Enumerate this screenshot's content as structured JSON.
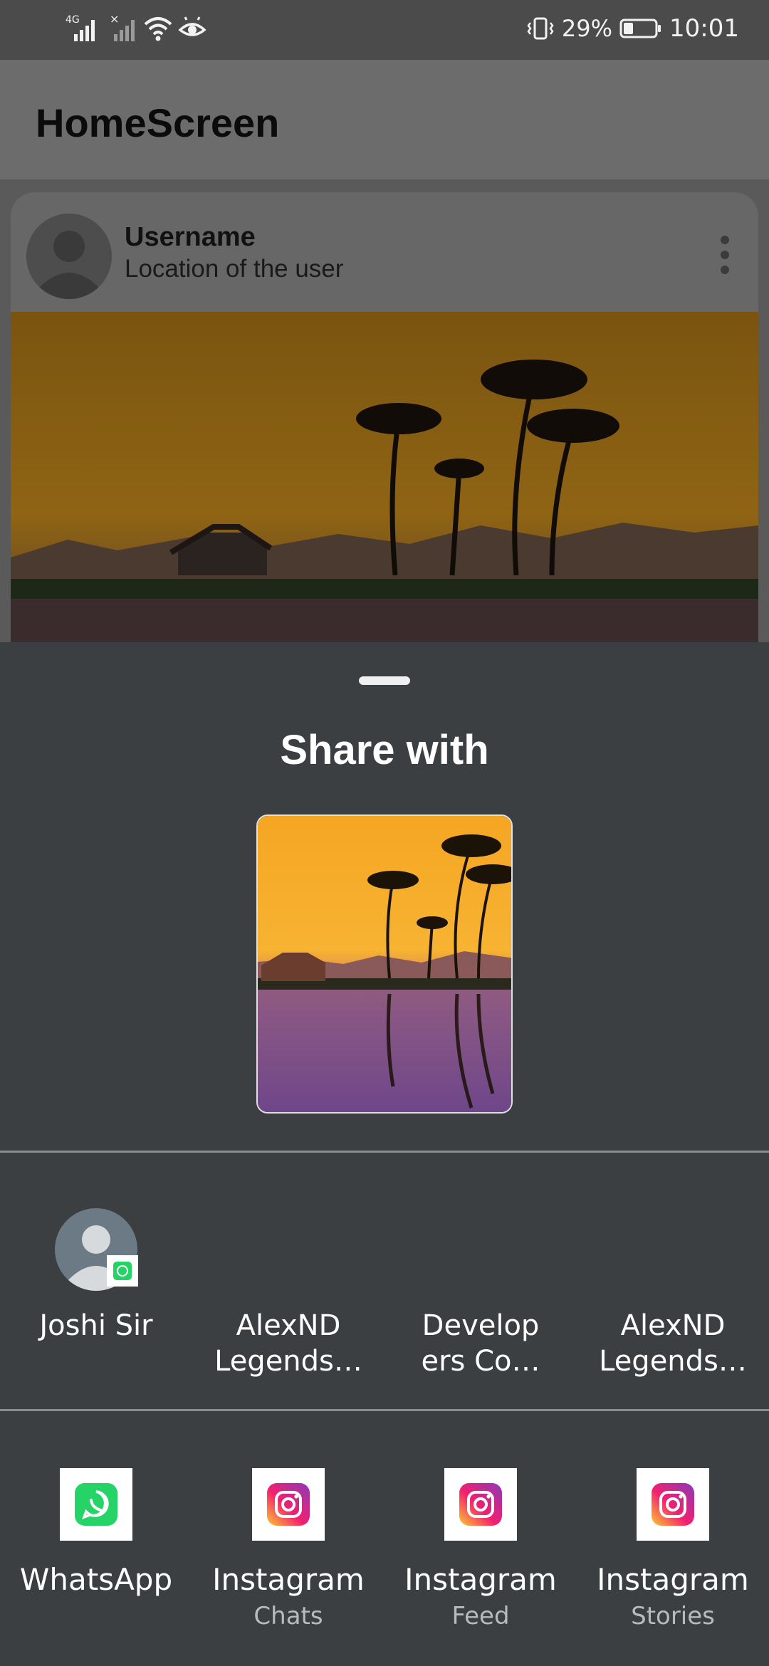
{
  "status_bar": {
    "network_label": "4G",
    "battery_percent": "29%",
    "time": "10:01"
  },
  "app_bar": {
    "title": "HomeScreen"
  },
  "post": {
    "username": "Username",
    "location": "Location of the user"
  },
  "share_sheet": {
    "title": "Share with",
    "contacts": [
      {
        "label": "Joshi Sir",
        "badge": "whatsapp-icon"
      },
      {
        "label": "AlexND Legends…"
      },
      {
        "label": "Develop ers Co…"
      },
      {
        "label": "AlexND Legends…"
      }
    ],
    "apps": [
      {
        "label": "WhatsApp",
        "sub": "",
        "icon": "whatsapp-icon"
      },
      {
        "label": "Instagram",
        "sub": "Chats",
        "icon": "instagram-icon"
      },
      {
        "label": "Instagram",
        "sub": "Feed",
        "icon": "instagram-icon"
      },
      {
        "label": "Instagram",
        "sub": "Stories",
        "icon": "instagram-icon"
      }
    ]
  },
  "colors": {
    "whatsapp": "#25d366",
    "sheet_bg": "#3c3f42",
    "scrim_appbar": "#6c6c6c"
  }
}
